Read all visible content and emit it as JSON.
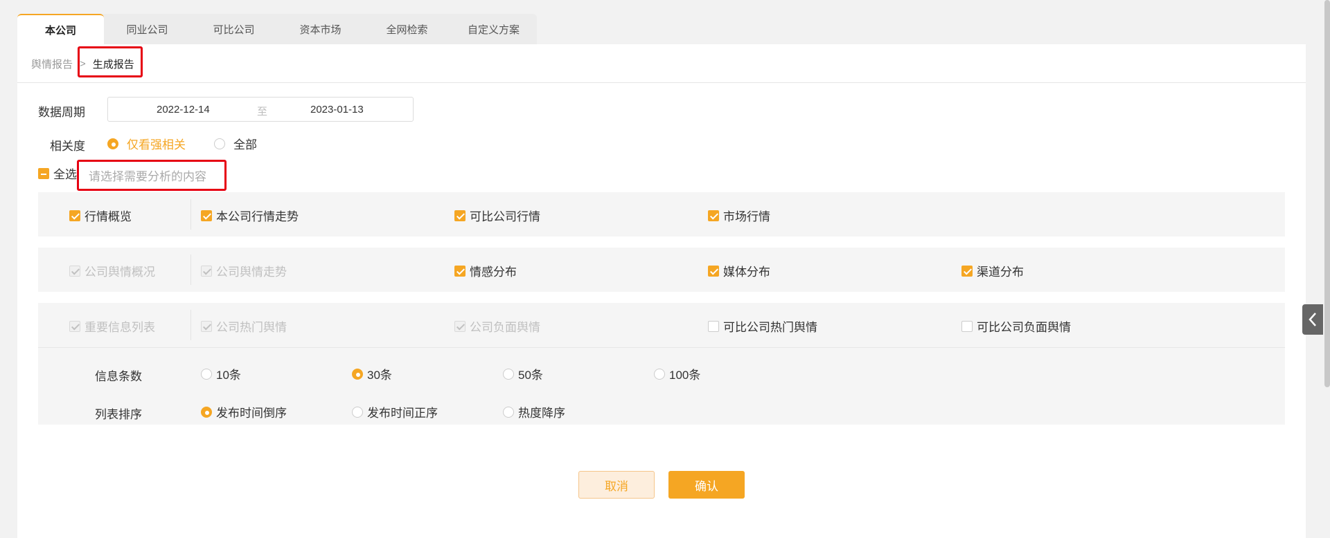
{
  "tabs": [
    "本公司",
    "同业公司",
    "可比公司",
    "资本市场",
    "全网检索",
    "自定义方案"
  ],
  "breadcrumb": {
    "parent": "舆情报告",
    "separator": ">",
    "current": "生成报告"
  },
  "period": {
    "label": "数据周期",
    "start": "2022-12-14",
    "to": "至",
    "end": "2023-01-13"
  },
  "relevance": {
    "label": "相关度",
    "options": [
      "仅看强相关",
      "全部"
    ],
    "selected": "仅看强相关"
  },
  "select_all": {
    "label": "全选",
    "hint": "请选择需要分析的内容"
  },
  "groups": {
    "market": {
      "title": "行情概览",
      "items": [
        "本公司行情走势",
        "可比公司行情",
        "市场行情"
      ]
    },
    "sentiment": {
      "title": "公司舆情概况",
      "items": [
        "公司舆情走势",
        "情感分布",
        "媒体分布",
        "渠道分布"
      ]
    },
    "info_list": {
      "title": "重要信息列表",
      "items": [
        "公司热门舆情",
        "公司负面舆情",
        "可比公司热门舆情",
        "可比公司负面舆情"
      ]
    }
  },
  "count": {
    "label": "信息条数",
    "options": [
      "10条",
      "30条",
      "50条",
      "100条"
    ],
    "selected": "30条"
  },
  "sort": {
    "label": "列表排序",
    "options": [
      "发布时间倒序",
      "发布时间正序",
      "热度降序"
    ],
    "selected": "发布时间倒序"
  },
  "buttons": {
    "cancel": "取消",
    "confirm": "确认"
  },
  "colors": {
    "accent": "#f5a623",
    "highlight": "#e60012"
  }
}
